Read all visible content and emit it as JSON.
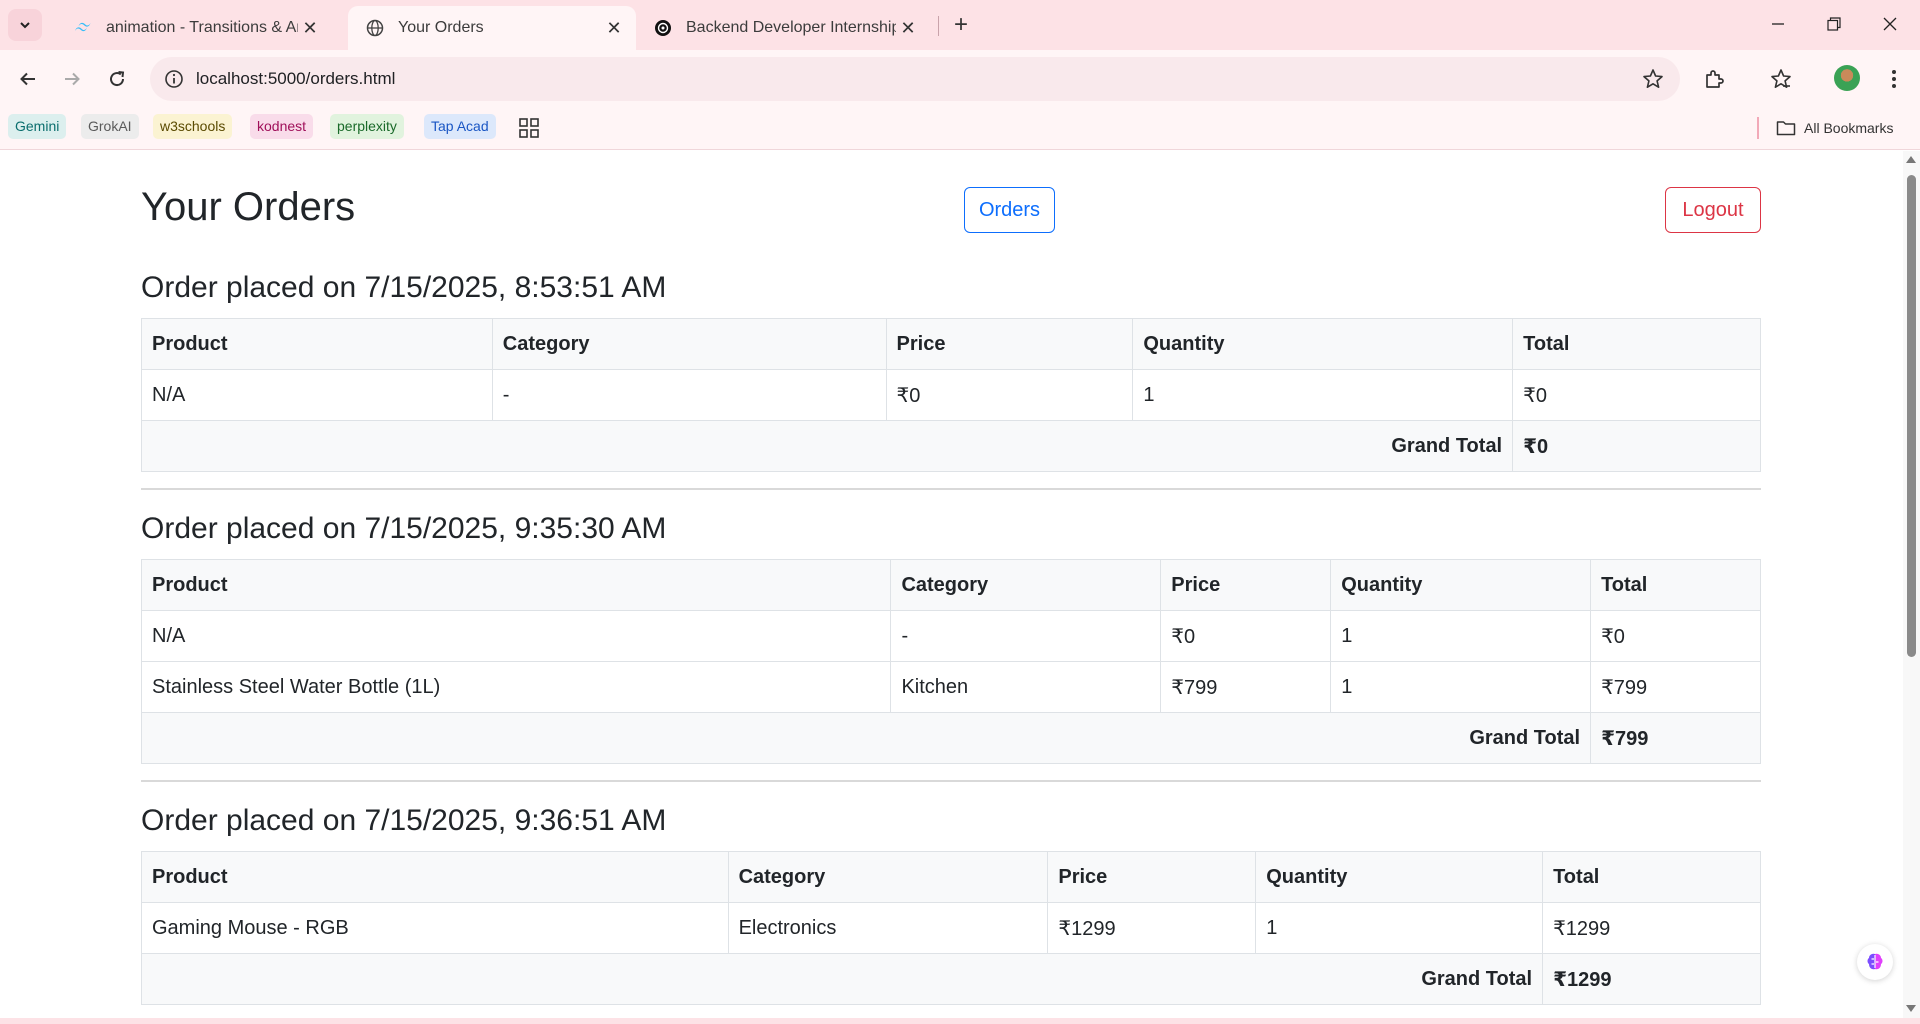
{
  "browser": {
    "tabs": [
      {
        "title": "animation - Transitions & Anim",
        "favicon": "tailwind-icon"
      },
      {
        "title": "Your Orders",
        "favicon": "globe-icon"
      },
      {
        "title": "Backend Developer Internship /",
        "favicon": "openai-icon"
      }
    ],
    "url": "localhost:5000/orders.html",
    "bookmarks": [
      {
        "label": "Gemini",
        "color": "#0b6e6e",
        "bg": "#dcefee"
      },
      {
        "label": "GrokAI",
        "color": "#5a5a5a",
        "bg": "#ececec"
      },
      {
        "label": "w3schools",
        "color": "#5a4a00",
        "bg": "#fbf3d2"
      },
      {
        "label": "kodnest",
        "color": "#a0105a",
        "bg": "#f9dcea"
      },
      {
        "label": "perplexity",
        "color": "#1a6a2a",
        "bg": "#e1f3de"
      },
      {
        "label": "Tap Acad",
        "color": "#1a56c4",
        "bg": "#dce8fb"
      }
    ],
    "all_bookmarks": "All Bookmarks"
  },
  "page": {
    "title": "Your Orders",
    "orders_button": "Orders",
    "logout_button": "Logout"
  },
  "orders": [
    {
      "heading": "Order placed on 7/15/2025, 8:53:51 AM",
      "columns": [
        "Product",
        "Category",
        "Price",
        "Quantity",
        "Total"
      ],
      "rows": [
        [
          "N/A",
          "-",
          "₹0",
          "1",
          "₹0"
        ]
      ],
      "grand_total_label": "Grand Total",
      "grand_total": "₹0"
    },
    {
      "heading": "Order placed on 7/15/2025, 9:35:30 AM",
      "columns": [
        "Product",
        "Category",
        "Price",
        "Quantity",
        "Total"
      ],
      "rows": [
        [
          "N/A",
          "-",
          "₹0",
          "1",
          "₹0"
        ],
        [
          "Stainless Steel Water Bottle (1L)",
          "Kitchen",
          "₹799",
          "1",
          "₹799"
        ]
      ],
      "grand_total_label": "Grand Total",
      "grand_total": "₹799"
    },
    {
      "heading": "Order placed on 7/15/2025, 9:36:51 AM",
      "columns": [
        "Product",
        "Category",
        "Price",
        "Quantity",
        "Total"
      ],
      "rows": [
        [
          "Gaming Mouse - RGB",
          "Electronics",
          "₹1299",
          "1",
          "₹1299"
        ]
      ],
      "grand_total_label": "Grand Total",
      "grand_total": "₹1299"
    }
  ]
}
